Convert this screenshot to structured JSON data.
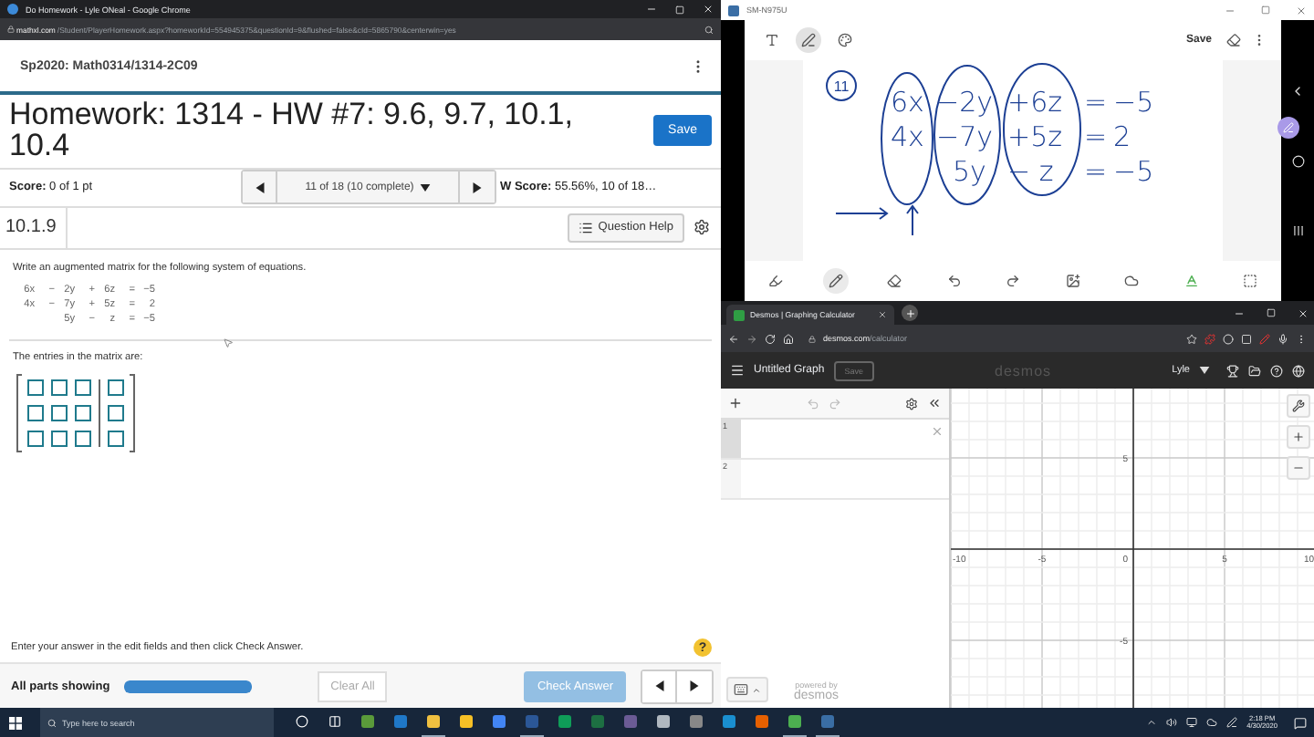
{
  "homework_window": {
    "title": "Do Homework - Lyle ONeal - Google Chrome",
    "url_host": "mathxl.com",
    "url_path": "/Student/PlayerHomework.aspx?homeworkId=554945375&questionId=9&flushed=false&cId=5865790&centerwin=yes"
  },
  "course": "Sp2020: Math0314/1314-2C09",
  "homework_title": "Homework: 1314 - HW #7: 9.6, 9.7, 10.1, 10.4",
  "save_button": "Save",
  "score": "**Score:** 0 of 1 pt",
  "question_nav": "11 of 18 (10 complete)",
  "hw_score": "**W Score:** 55.56%, 10 of 18…",
  "question_id": "10.1.9",
  "question_help": "Question Help",
  "instruction": "Write an augmented matrix for the following system of equations.",
  "equations": [
    {
      "x": "6x",
      "op1": "−",
      "y": "2y",
      "op2": "+",
      "z": "6z",
      "eq": "=",
      "rhs": "−5"
    },
    {
      "x": "4x",
      "op1": "−",
      "y": "7y",
      "op2": "+",
      "z": "5z",
      "eq": "=",
      "rhs": "2"
    },
    {
      "y": "5y",
      "op2": "−",
      "z": "z",
      "eq": "=",
      "rhs": "−5"
    }
  ],
  "matrix_prompt": "The entries in the matrix are:",
  "matrix": [
    [
      {
        "kind": "coefficient"
      },
      {
        "kind": "coefficient"
      },
      {
        "kind": "coefficient"
      },
      {
        "kind": "constant"
      }
    ],
    [
      {
        "kind": "coefficient"
      },
      {
        "kind": "coefficient"
      },
      {
        "kind": "coefficient"
      },
      {
        "kind": "constant"
      }
    ],
    [
      {
        "kind": "coefficient"
      },
      {
        "kind": "coefficient"
      },
      {
        "kind": "coefficient"
      },
      {
        "kind": "constant"
      }
    ]
  ],
  "footer_hint": "Enter your answer in the edit fields and then click Check Answer.",
  "help_mark": "?",
  "parts_label": "All parts showing",
  "parts_progress": {
    "level": 1
  },
  "clear_button": {
    "label": "Clear All",
    "disabled": true
  },
  "check_button": {
    "label": "Check Answer",
    "disabled": true
  },
  "whiteboard": {
    "title": "SM-N975U",
    "save": "Save",
    "top_tools": [
      {
        "kind": "text",
        "selected": false
      },
      {
        "kind": "pen",
        "selected": true
      },
      {
        "kind": "style",
        "selected": false
      }
    ],
    "page_number": "11",
    "rows": [
      {
        "x": "6x",
        "y": "−2y",
        "z": "+6z",
        "eq": "=",
        "rhs": "−5"
      },
      {
        "x": "4x",
        "y": "−7y",
        "z": "+5z",
        "eq": "=",
        "rhs": "2"
      },
      {
        "y": "5y",
        "z": "− z",
        "eq": "=",
        "rhs": "−5"
      }
    ],
    "bottom_tools": [
      {
        "kind": "marker",
        "selected": false
      },
      {
        "kind": "pen",
        "selected": true
      },
      {
        "kind": "eraser",
        "selected": false
      },
      {
        "kind": "undo",
        "selected": false
      },
      {
        "kind": "redo",
        "selected": false
      },
      {
        "kind": "image",
        "selected": false
      },
      {
        "kind": "shape",
        "selected": false
      },
      {
        "kind": "text",
        "selected": false
      },
      {
        "kind": "select",
        "selected": false
      }
    ]
  },
  "desmos": {
    "tab": "Desmos | Graphing Calculator",
    "url_host": "desmos.com",
    "url_path": "/calculator",
    "graph_title": "Untitled Graph",
    "save": {
      "label": "Save",
      "disabled": true
    },
    "logo": "desmos",
    "user": "Lyle",
    "expressions": [
      {
        "number": "1",
        "selected": true
      },
      {
        "number": "2",
        "selected": false
      }
    ],
    "powered_by": "powered by",
    "powered_logo": "desmos",
    "x_ticks": [
      "-10",
      "-5",
      "0",
      "5",
      "10"
    ],
    "y_ticks": [
      "5",
      "-5"
    ]
  },
  "taskbar": {
    "search_placeholder": "Type here to search",
    "apps": [
      {
        "kind": "cortana",
        "active": false
      },
      {
        "kind": "taskview",
        "active": false
      },
      {
        "kind": "store",
        "active": false
      },
      {
        "kind": "mail",
        "active": false
      },
      {
        "kind": "explorer",
        "active": true
      },
      {
        "kind": "keep",
        "active": false
      },
      {
        "kind": "docs",
        "active": false
      },
      {
        "kind": "word",
        "active": true
      },
      {
        "kind": "sheets",
        "active": false
      },
      {
        "kind": "excel",
        "active": false
      },
      {
        "kind": "calendar",
        "active": false
      },
      {
        "kind": "cloud",
        "active": false
      },
      {
        "kind": "phone",
        "active": false
      },
      {
        "kind": "edge",
        "active": false
      },
      {
        "kind": "firefox",
        "active": false
      },
      {
        "kind": "chrome",
        "active": true
      },
      {
        "kind": "notebook",
        "active": true
      }
    ],
    "time": "2:18 PM",
    "date": "4/30/2020"
  }
}
